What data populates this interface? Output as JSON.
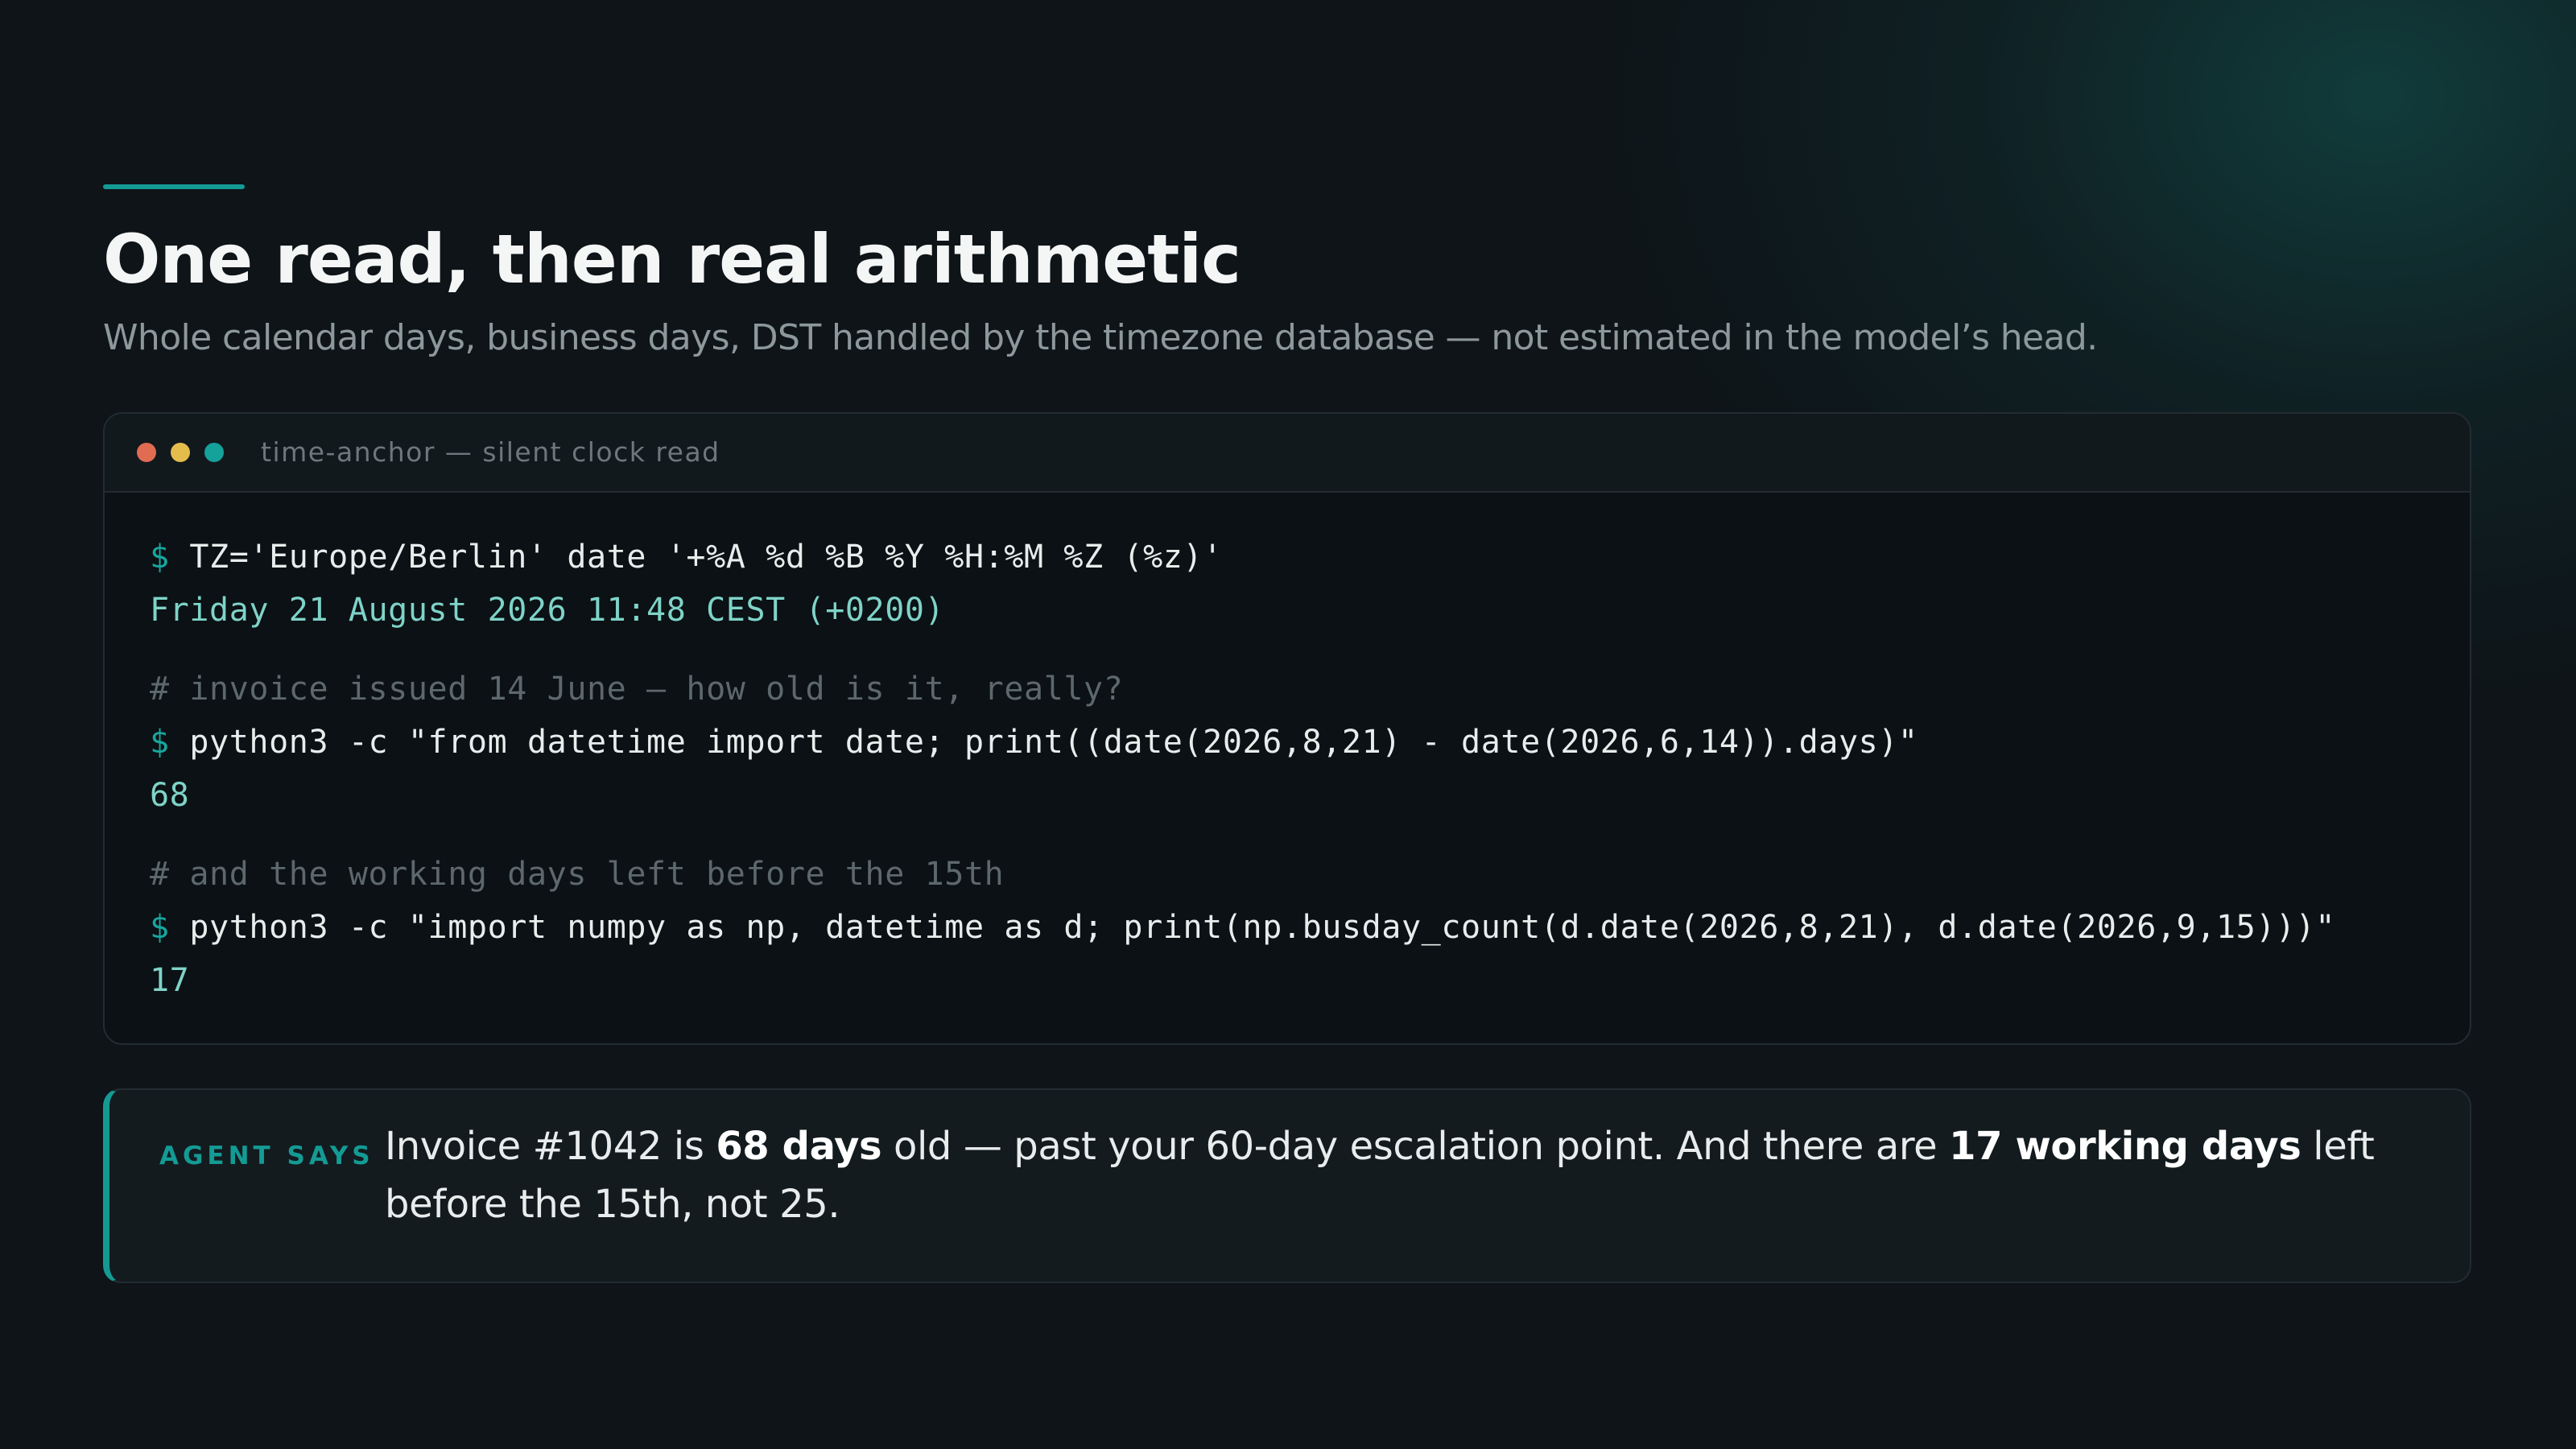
{
  "slide": {
    "title": "One read, then real arithmetic",
    "subtitle": "Whole calendar days, business days, DST handled by the timezone database — not estimated in the model’s head."
  },
  "terminal": {
    "title": "time-anchor — silent clock read",
    "prompt_symbol": "$",
    "lines": [
      {
        "kind": "command",
        "text": "TZ='Europe/Berlin' date '+%A %d %B %Y %H:%M %Z (%z)'"
      },
      {
        "kind": "output",
        "text": "Friday 21 August 2026 11:48 CEST (+0200)"
      },
      {
        "kind": "comment",
        "text": "# invoice issued 14 June — how old is it, really?"
      },
      {
        "kind": "command",
        "text": "python3 -c \"from datetime import date; print((date(2026,8,21) - date(2026,6,14)).days)\""
      },
      {
        "kind": "output",
        "text": "68"
      },
      {
        "kind": "comment",
        "text": "# and the working days left before the 15th"
      },
      {
        "kind": "command",
        "text": "python3 -c \"import numpy as np, datetime as d; print(np.busday_count(d.date(2026,8,21), d.date(2026,9,15)))\""
      },
      {
        "kind": "output",
        "text": "17"
      }
    ]
  },
  "callout": {
    "label": "AGENT SAYS",
    "text_part1": "Invoice #1042 is ",
    "bold1": "68 days",
    "text_part2": " old — past your 60-day escalation point. And there are ",
    "bold2": "17 working days",
    "text_part3": " left before the 15th, not 25."
  },
  "colors": {
    "accent": "#139b94",
    "background": "#0e1418",
    "terminal_output": "#7fd3c8",
    "window_dot_red": "#e06c52",
    "window_dot_yellow": "#e4bd4c",
    "window_dot_green": "#15a29b"
  }
}
